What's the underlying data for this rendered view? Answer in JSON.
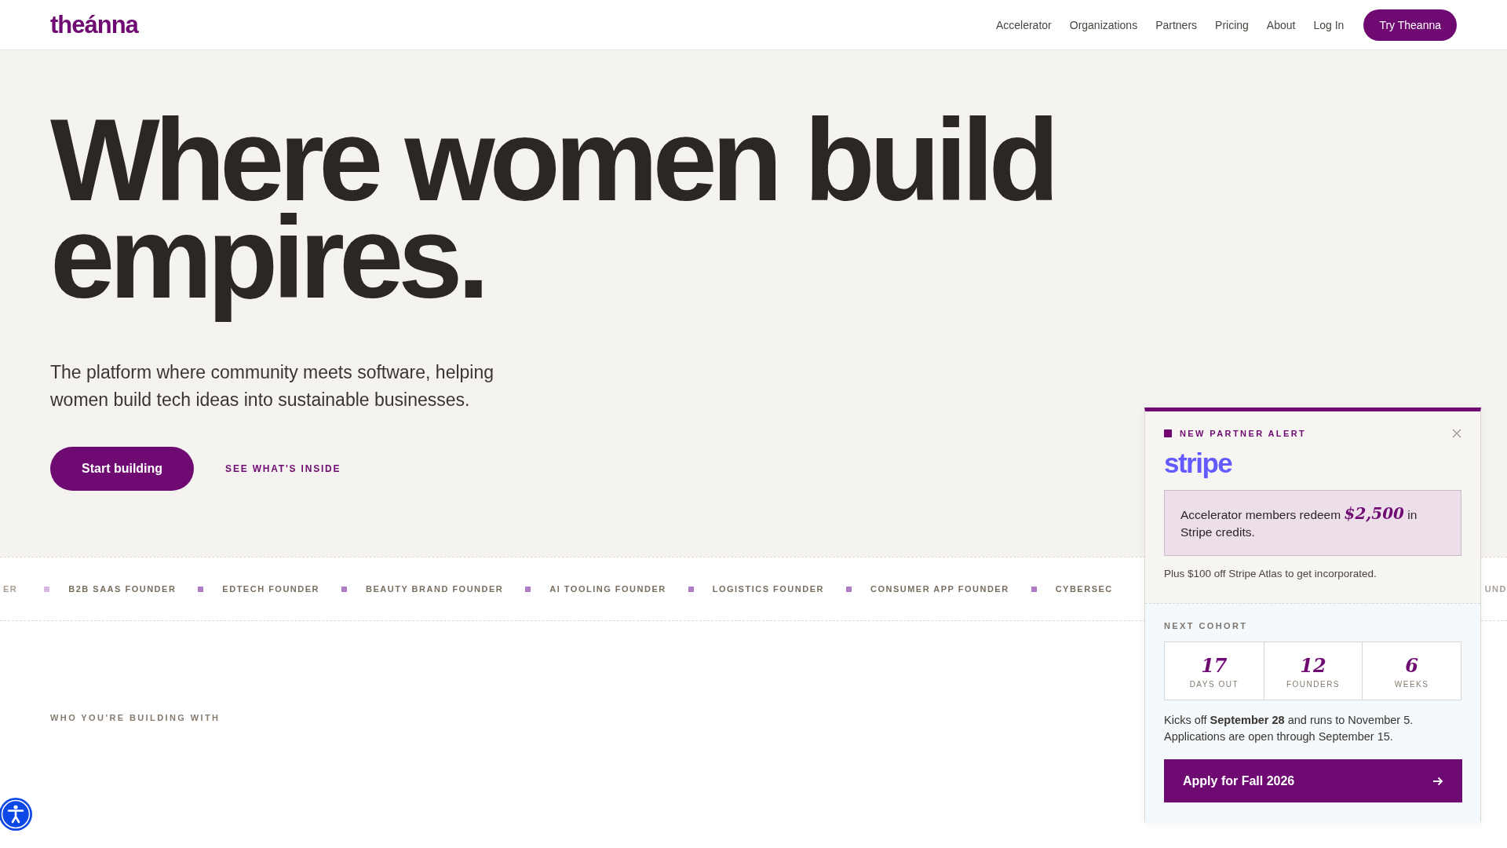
{
  "header": {
    "logo": "theánna",
    "nav": [
      {
        "label": "Accelerator"
      },
      {
        "label": "Organizations"
      },
      {
        "label": "Partners"
      },
      {
        "label": "Pricing"
      },
      {
        "label": "About"
      },
      {
        "label": "Log In"
      }
    ],
    "cta": "Try Theanna"
  },
  "hero": {
    "headline_lines": [
      "Where women build",
      "empires."
    ],
    "subtitle": "The platform where community meets software, helping women build tech ideas into sustainable businesses.",
    "primary_button": "Start building",
    "secondary_link": "SEE WHAT'S INSIDE"
  },
  "ticker": [
    {
      "label": "ER",
      "faded": true
    },
    {
      "label": "B2B SAAS FOUNDER",
      "faded": false
    },
    {
      "label": "EDTECH FOUNDER",
      "faded": false
    },
    {
      "label": "BEAUTY BRAND FOUNDER",
      "faded": false
    },
    {
      "label": "AI TOOLING FOUNDER",
      "faded": false
    },
    {
      "label": "LOGISTICS FOUNDER",
      "faded": false
    },
    {
      "label": "CONSUMER APP FOUNDER",
      "faded": false
    },
    {
      "label": "CYBERSEC",
      "faded": false
    },
    {
      "label": "UND",
      "faded": true
    }
  ],
  "section_label": "WHO YOU'RE BUILDING WITH",
  "popup": {
    "eyebrow": "NEW PARTNER ALERT",
    "partner_logo": "stripe",
    "offer": {
      "before": "Accelerator members redeem",
      "amount": "$2,500",
      "after": "in Stripe credits."
    },
    "note": "Plus $100 off Stripe Atlas to get incorporated.",
    "cohort_label": "NEXT COHORT",
    "stats": [
      {
        "value": "17",
        "label": "DAYS OUT"
      },
      {
        "value": "12",
        "label": "FOUNDERS"
      },
      {
        "value": "6",
        "label": "WEEKS"
      }
    ],
    "details": "Kicks off **September 28** and runs to November 5. Applications are open through September 15.",
    "apply_button": "Apply for Fall 2026"
  }
}
